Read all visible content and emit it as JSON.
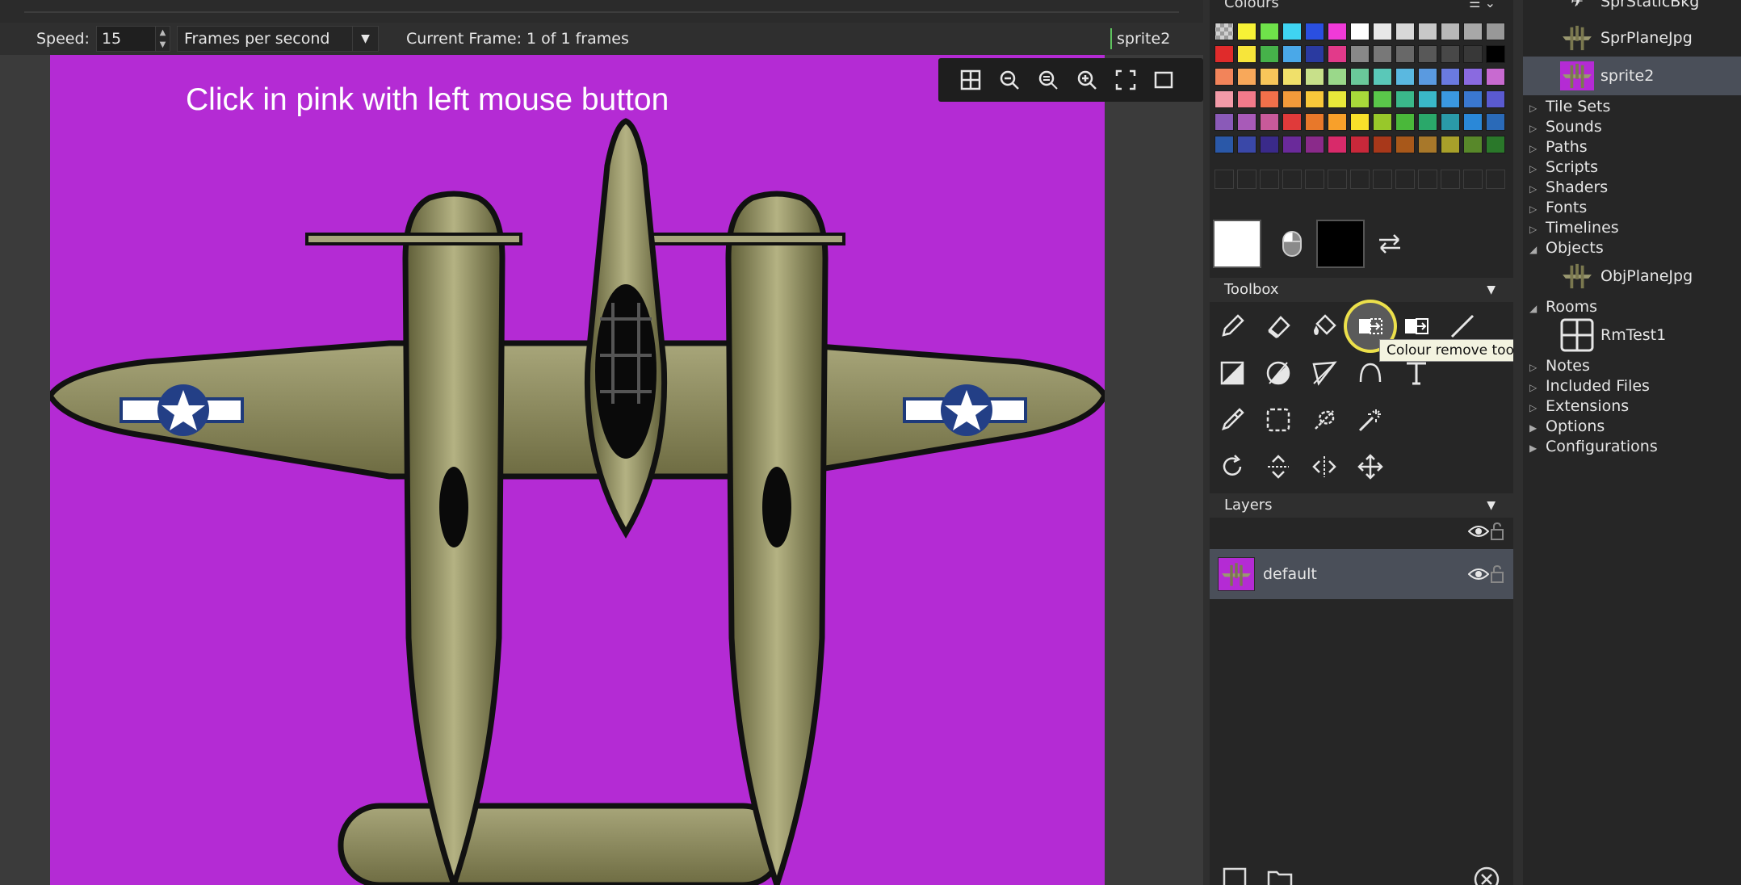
{
  "editor": {
    "speed_label": "Speed:",
    "speed_value": "15",
    "speed_unit": "Frames per second",
    "current_frame": "Current Frame: 1 of 1 frames",
    "sprite_name": "sprite2",
    "canvas_text": "Click in pink with left mouse button",
    "canvas_color": "#b42bd4"
  },
  "colours": {
    "header": "Colours",
    "primary": "#ffffff",
    "secondary": "#000000",
    "palette": [
      [
        "transparent",
        "#f7f236",
        "#6fe24a",
        "#3fd4f2",
        "#2a4fe0",
        "#f03ad8",
        "#ffffff",
        "#e8e8e8",
        "#d8d8d8",
        "#c8c8c8",
        "#b8b8b8",
        "#a8a8a8",
        "#989898"
      ],
      [
        "#e02b2b",
        "#f7e53a",
        "#46b24a",
        "#4aa8e8",
        "#2a3aa0",
        "#e23a8a",
        "#888888",
        "#787878",
        "#686868",
        "#585858",
        "#484848",
        "#383838",
        "#000000"
      ],
      [
        "#f2845a",
        "#f8a85a",
        "#f8c65a",
        "#f0e06a",
        "#c8e08a",
        "#9ad88a",
        "#6ac89a",
        "#5ac8b8",
        "#5ab8e0",
        "#5a9ae0",
        "#6a7ae0",
        "#8a6ae0",
        "#c86ad0"
      ],
      [
        "#f29aa8",
        "#f27a8a",
        "#f2704a",
        "#f29a3a",
        "#f8c83a",
        "#e8e83a",
        "#a8d83a",
        "#5ac84a",
        "#3ab88a",
        "#3ab8c8",
        "#3a98e0",
        "#3a78d0",
        "#5a5ad0"
      ],
      [
        "#8a5ab8",
        "#a85ab8",
        "#c85a9a",
        "#e03a3a",
        "#e8782a",
        "#f8a02a",
        "#f8e02a",
        "#98c82a",
        "#4ab83a",
        "#2aa86a",
        "#2a9aa8",
        "#2a88d8",
        "#2a6ab8"
      ],
      [
        "#2a58a8",
        "#3a48a8",
        "#3a2a8a",
        "#6a2a9a",
        "#8a2a8a",
        "#d82a6a",
        "#c8283a",
        "#a8381a",
        "#a8581a",
        "#a8782a",
        "#a8a02a",
        "#58882a",
        "#2a782a"
      ]
    ]
  },
  "toolbox": {
    "header": "Toolbox",
    "tooltip": "Colour remove tool(H)"
  },
  "layers": {
    "header": "Layers",
    "items": [
      {
        "name": "default"
      }
    ]
  },
  "tree": {
    "items": [
      {
        "label": "SprStaticBkg"
      },
      {
        "label": "SprPlaneJpg"
      },
      {
        "label": "sprite2"
      },
      {
        "label": "Tile Sets"
      },
      {
        "label": "Sounds"
      },
      {
        "label": "Paths"
      },
      {
        "label": "Scripts"
      },
      {
        "label": "Shaders"
      },
      {
        "label": "Fonts"
      },
      {
        "label": "Timelines"
      },
      {
        "label": "Objects"
      },
      {
        "label": "ObjPlaneJpg"
      },
      {
        "label": "Rooms"
      },
      {
        "label": "RmTest1"
      },
      {
        "label": "Notes"
      },
      {
        "label": "Included Files"
      },
      {
        "label": "Extensions"
      },
      {
        "label": "Options"
      },
      {
        "label": "Configurations"
      }
    ]
  }
}
